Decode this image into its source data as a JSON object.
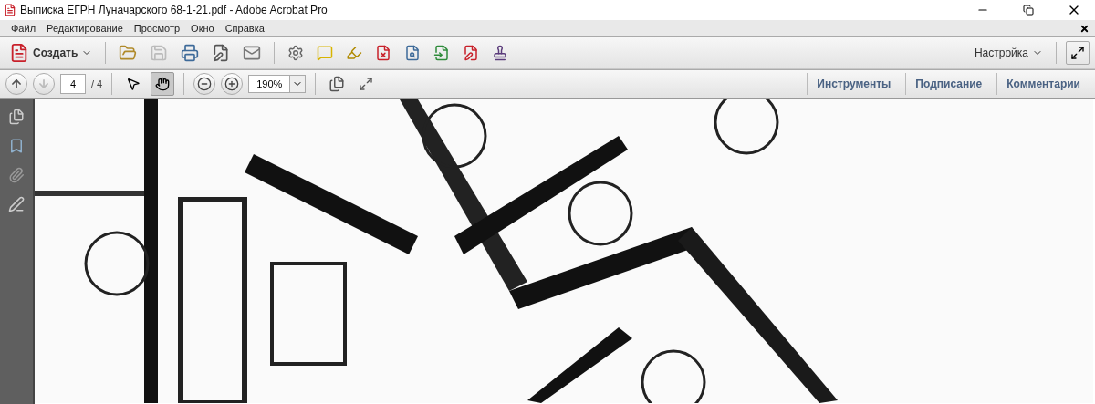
{
  "window": {
    "title": "Выписка ЕГРН Луначарского 68-1-21.pdf - Adobe Acrobat Pro"
  },
  "menu": [
    "Файл",
    "Редактирование",
    "Просмотр",
    "Окно",
    "Справка"
  ],
  "toolbar": {
    "create_label": "Создать",
    "customize_label": "Настройка"
  },
  "navigation": {
    "page": "4",
    "total": "/ 4",
    "zoom": "190%"
  },
  "tools": [
    {
      "kind": "select",
      "selected": false
    },
    {
      "kind": "hand",
      "selected": true
    }
  ],
  "panels": [
    "Инструменты",
    "Подписание",
    "Комментарии"
  ]
}
